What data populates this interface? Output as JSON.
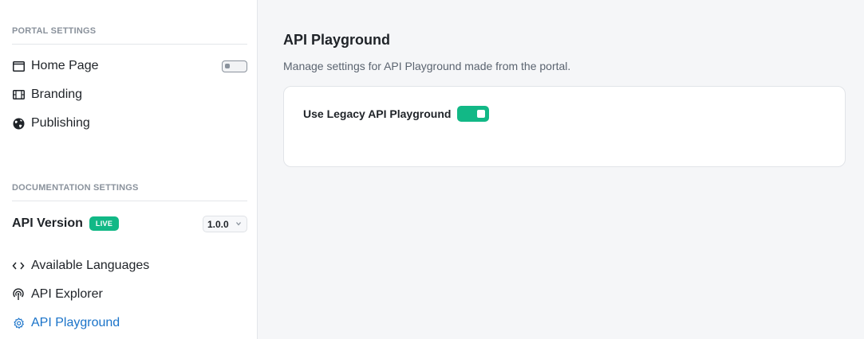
{
  "sidebar": {
    "portal_heading": "PORTAL SETTINGS",
    "portal_items": [
      {
        "label": "Home Page",
        "icon": "window-icon"
      },
      {
        "label": "Branding",
        "icon": "film-icon"
      },
      {
        "label": "Publishing",
        "icon": "globe-icon"
      }
    ],
    "docs_heading": "DOCUMENTATION SETTINGS",
    "api_version_label": "API Version",
    "live_badge": "LIVE",
    "version_value": "1.0.0",
    "docs_items": [
      {
        "label": "Available Languages",
        "icon": "code-icon"
      },
      {
        "label": "API Explorer",
        "icon": "broadcast-icon"
      },
      {
        "label": "API Playground",
        "icon": "gear-icon"
      }
    ],
    "active_item": "API Playground"
  },
  "main": {
    "title": "API Playground",
    "description": "Manage settings for API Playground made from the portal.",
    "setting_label": "Use Legacy API Playground",
    "setting_enabled": true
  },
  "colors": {
    "accent": "#12b886",
    "active_link": "#1a73c9",
    "muted": "#8a929c"
  }
}
